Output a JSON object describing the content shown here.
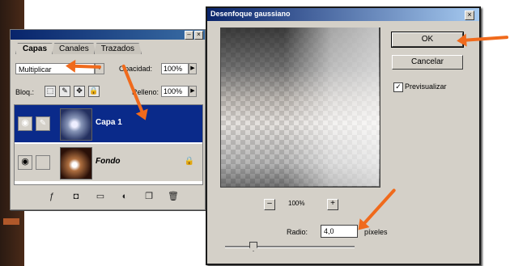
{
  "layers_panel": {
    "tabs": [
      {
        "label": "Capas",
        "active": true
      },
      {
        "label": "Canales",
        "active": false
      },
      {
        "label": "Trazados",
        "active": false
      }
    ],
    "blend_mode": "Multiplicar",
    "opacity_label": "Opacidad:",
    "opacity_value": "100%",
    "lock_label": "Bloq.:",
    "fill_label": "Relleno:",
    "fill_value": "100%",
    "layers": [
      {
        "name": "Capa 1",
        "selected": true
      },
      {
        "name": "Fondo",
        "selected": false,
        "locked": true
      }
    ],
    "toolbar_icons": [
      "link-icon",
      "style-icon",
      "mask-icon",
      "adjustment-icon",
      "new-set-icon",
      "new-layer-icon",
      "trash-icon"
    ]
  },
  "dialog": {
    "title": "Desenfoque gaussiano",
    "ok_label": "OK",
    "cancel_label": "Cancelar",
    "preview_label": "Previsualizar",
    "preview_checked": true,
    "zoom": "100%",
    "zoom_minus": "–",
    "zoom_plus": "+",
    "radius_label": "Radio:",
    "radius_value": "4,0",
    "radius_unit": "píxeles"
  },
  "annotations": {
    "arrow_color": "#f06a1c"
  }
}
